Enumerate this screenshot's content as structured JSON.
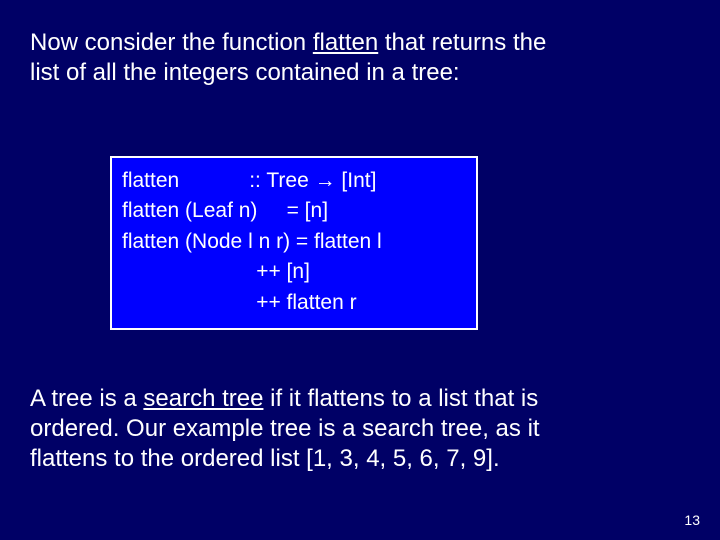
{
  "intro": {
    "pre": "Now consider the function ",
    "keyword": "flatten",
    "post1": " that returns the",
    "line2": "list of all the integers contained in a tree:"
  },
  "code": {
    "l1": "flatten            :: Tree → [Int]",
    "l2": "flatten (Leaf n)     = [n]",
    "l3": "flatten (Node l n r) = flatten l",
    "l4": "                       ++ [n]",
    "l5": "                       ++ flatten r"
  },
  "conclusion": {
    "a": "A tree is a ",
    "b": "search tree",
    "c": " if it flattens to a list that is",
    "line2": "ordered.  Our example tree is a search tree, as it",
    "line3": "flattens to the ordered list [1, 3, 4, 5, 6, 7, 9]."
  },
  "pagenum": "13"
}
